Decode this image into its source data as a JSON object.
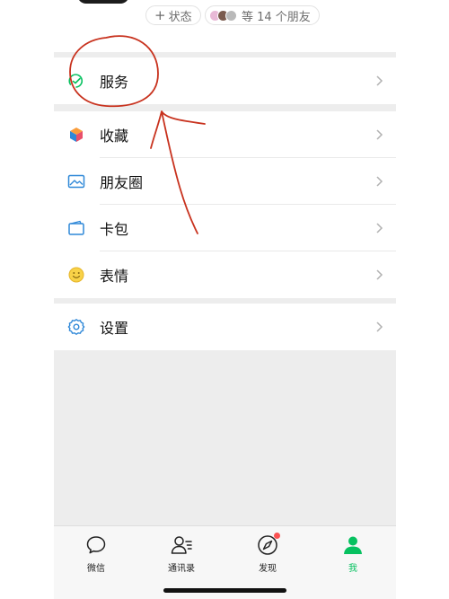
{
  "profile": {
    "status_label": "状态",
    "friends_label": "等 14 个朋友",
    "mini_avatar_colors": [
      "#e8b9d6",
      "#7a5a4d",
      "#b9b9b9"
    ]
  },
  "menu": {
    "services": {
      "label": "服务",
      "icon": "service-icon"
    },
    "items": [
      {
        "label": "收藏",
        "icon": "favorites-cube-icon"
      },
      {
        "label": "朋友圈",
        "icon": "moments-image-icon"
      },
      {
        "label": "卡包",
        "icon": "card-wallet-icon"
      },
      {
        "label": "表情",
        "icon": "sticker-smiley-icon"
      }
    ],
    "settings": {
      "label": "设置",
      "icon": "gear-icon"
    }
  },
  "tabbar": {
    "tabs": [
      {
        "label": "微信",
        "icon": "chat-bubble-icon",
        "active": false
      },
      {
        "label": "通讯录",
        "icon": "contacts-icon",
        "active": false
      },
      {
        "label": "发现",
        "icon": "compass-icon",
        "active": false,
        "badge_dot": true
      },
      {
        "label": "我",
        "icon": "person-icon",
        "active": true
      }
    ]
  },
  "colors": {
    "accent_green": "#07c160",
    "icon_blue": "#2f88d8",
    "annotation_red": "#c8321e",
    "background_gray": "#ededed"
  }
}
